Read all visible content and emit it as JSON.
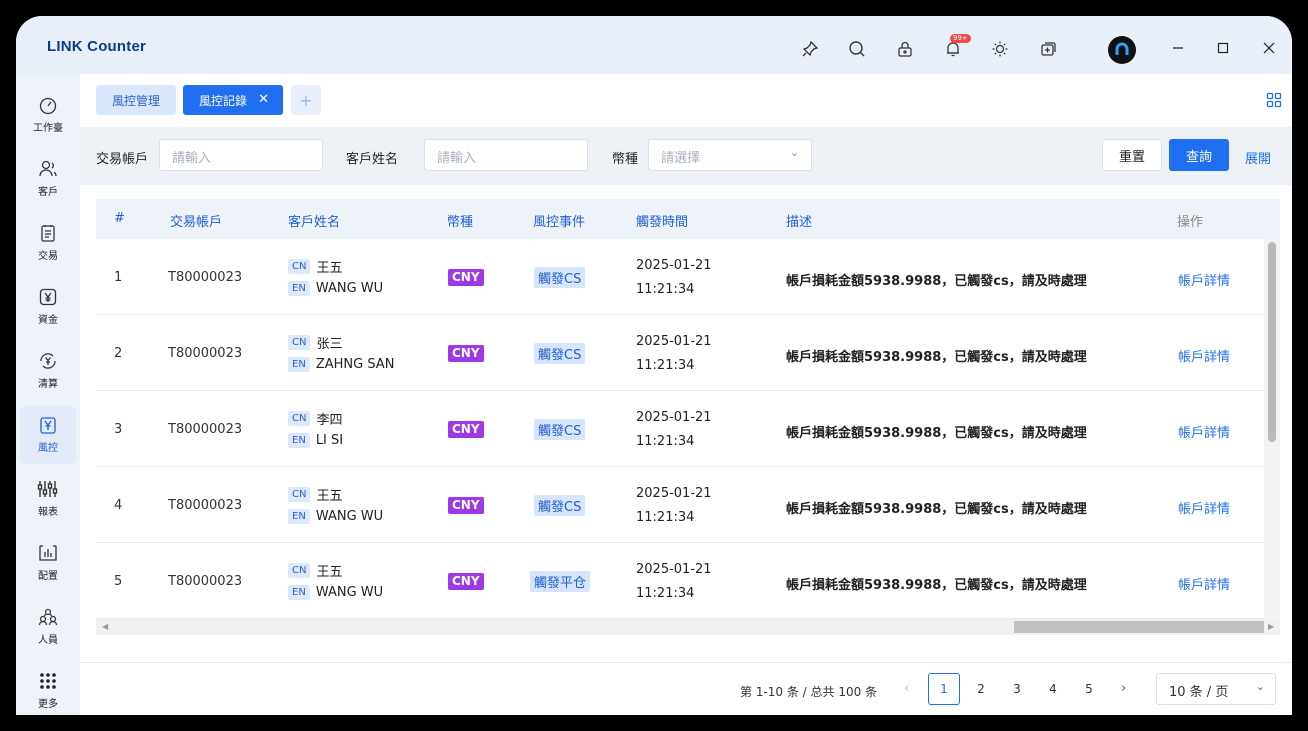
{
  "app": {
    "title": "LINK Counter",
    "notification_badge": "99+"
  },
  "sidebar": {
    "items": [
      {
        "label": "工作臺",
        "icon": "dashboard-icon"
      },
      {
        "label": "客戶",
        "icon": "users-icon"
      },
      {
        "label": "交易",
        "icon": "clipboard-icon"
      },
      {
        "label": "資金",
        "icon": "yen-icon"
      },
      {
        "label": "清算",
        "icon": "exchange-icon"
      },
      {
        "label": "風控",
        "icon": "shield-yen-icon"
      },
      {
        "label": "報表",
        "icon": "sliders-icon"
      },
      {
        "label": "配置",
        "icon": "settings-chart-icon"
      },
      {
        "label": "人員",
        "icon": "people-icon"
      },
      {
        "label": "更多",
        "icon": "grid-dots-icon"
      }
    ],
    "active": "風控"
  },
  "tabs": {
    "items": [
      {
        "label": "風控管理"
      },
      {
        "label": "風控記錄"
      }
    ],
    "add_label": "+"
  },
  "filter": {
    "account_label": "交易帳戶",
    "account_placeholder": "請輸入",
    "name_label": "客戶姓名",
    "name_placeholder": "請輸入",
    "currency_label": "幣種",
    "currency_placeholder": "請選擇",
    "reset_label": "重置",
    "query_label": "查詢",
    "expand_label": "展開"
  },
  "table": {
    "columns": [
      "#",
      "交易帳戶",
      "客戶姓名",
      "幣種",
      "風控事件",
      "觸發時間",
      "描述",
      "操作"
    ],
    "rows": [
      {
        "idx": "1",
        "account": "T80000023",
        "cn_tag": "CN",
        "cn_name": "王五",
        "en_tag": "EN",
        "en_name": "WANG WU",
        "currency": "CNY",
        "event": "觸發CS",
        "date": "2025-01-21",
        "time": "11:21:34",
        "desc": "帳戶損耗金額5938.9988，已觸發cs，請及時處理",
        "op": "帳戶詳情"
      },
      {
        "idx": "2",
        "account": "T80000023",
        "cn_tag": "CN",
        "cn_name": "张三",
        "en_tag": "EN",
        "en_name": "ZAHNG SAN",
        "currency": "CNY",
        "event": "觸發CS",
        "date": "2025-01-21",
        "time": "11:21:34",
        "desc": "帳戶損耗金額5938.9988，已觸發cs，請及時處理",
        "op": "帳戶詳情"
      },
      {
        "idx": "3",
        "account": "T80000023",
        "cn_tag": "CN",
        "cn_name": "李四",
        "en_tag": "EN",
        "en_name": "LI SI",
        "currency": "CNY",
        "event": "觸發CS",
        "date": "2025-01-21",
        "time": "11:21:34",
        "desc": "帳戶損耗金額5938.9988，已觸發cs，請及時處理",
        "op": "帳戶詳情"
      },
      {
        "idx": "4",
        "account": "T80000023",
        "cn_tag": "CN",
        "cn_name": "王五",
        "en_tag": "EN",
        "en_name": "WANG WU",
        "currency": "CNY",
        "event": "觸發CS",
        "date": "2025-01-21",
        "time": "11:21:34",
        "desc": "帳戶損耗金額5938.9988，已觸發cs，請及時處理",
        "op": "帳戶詳情"
      },
      {
        "idx": "5",
        "account": "T80000023",
        "cn_tag": "CN",
        "cn_name": "王五",
        "en_tag": "EN",
        "en_name": "WANG WU",
        "currency": "CNY",
        "event": "觸發平仓",
        "date": "2025-01-21",
        "time": "11:21:34",
        "desc": "帳戶損耗金額5938.9988，已觸發cs，請及時處理",
        "op": "帳戶詳情"
      }
    ]
  },
  "pagination": {
    "total_text": "第 1-10 条 / 总共 100 条",
    "pages": [
      "1",
      "2",
      "3",
      "4",
      "5"
    ],
    "current": "1",
    "prev": "‹",
    "next": "›",
    "page_size": "10 条 / 页"
  },
  "colors": {
    "primary": "#1f6ff0",
    "currency_tag": "#9d39e6",
    "event_tag_bg": "#d6e5fa"
  }
}
